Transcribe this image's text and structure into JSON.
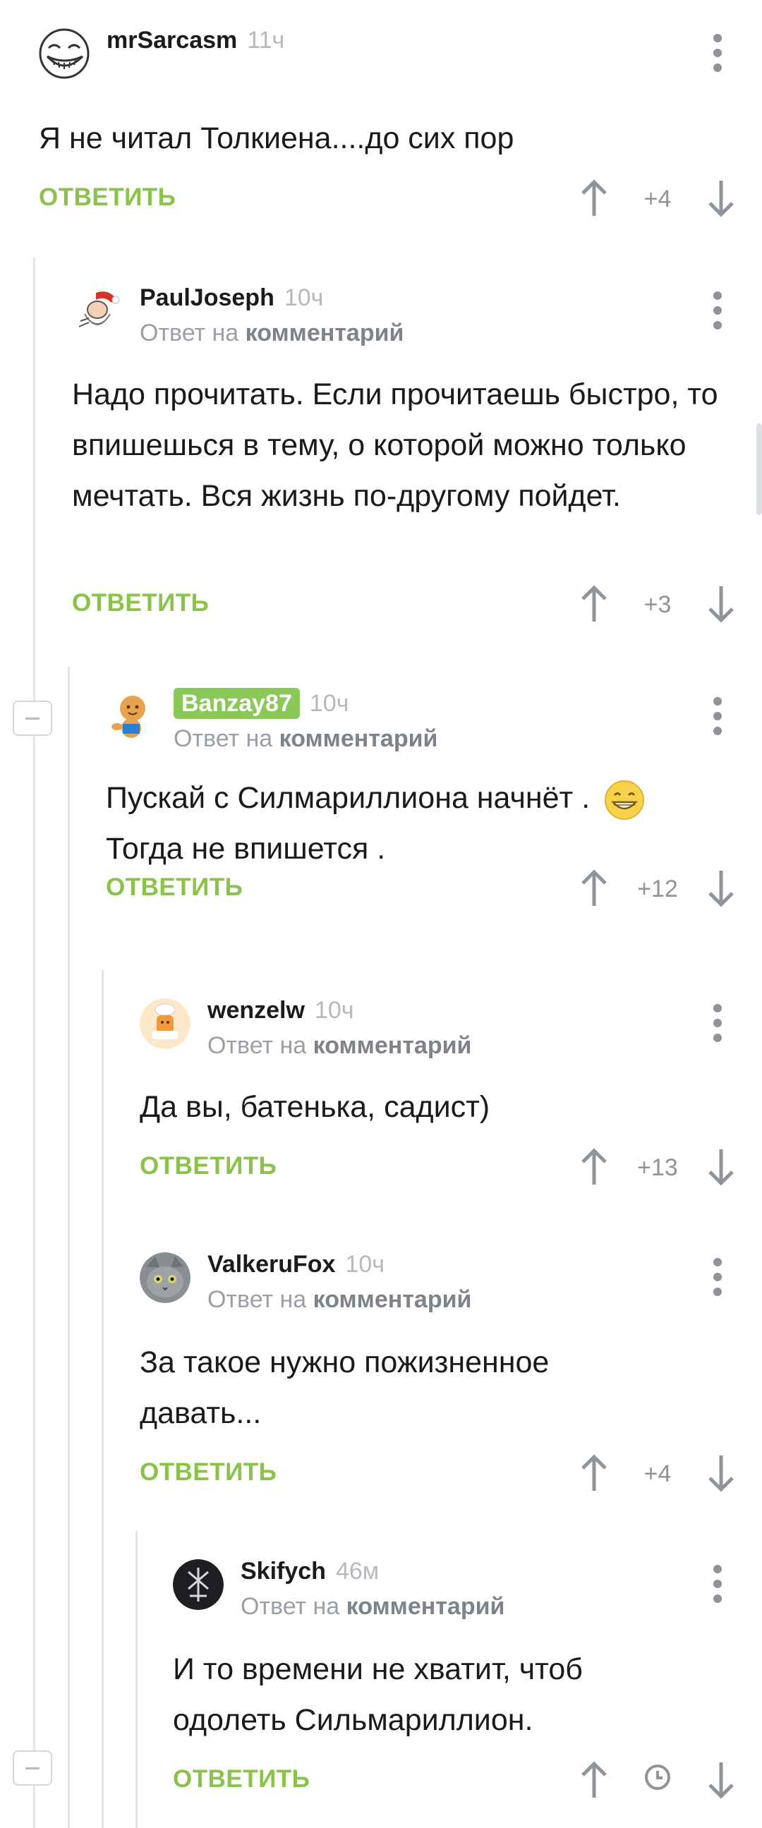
{
  "labels": {
    "reply": "ОТВЕТИТЬ",
    "reply_to": "Ответ на",
    "comment_word": "комментарий"
  },
  "colors": {
    "accent_green": "#8bc34a",
    "badge_green": "#8ac858"
  },
  "comments": [
    {
      "author": "mrSarcasm",
      "time": "11ч",
      "text": "Я не читал Толкиена....до сих пор",
      "rating": "+4",
      "avatar_icon": "trollface-icon"
    },
    {
      "author": "PaulJoseph",
      "time": "10ч",
      "text": "Надо прочитать. Если прочитаешь быстро, то впишешься в тему, о которой можно только мечтать. Вся жизнь по-другому пойдет.",
      "rating": "+3",
      "avatar_icon": "santa-avatar-icon"
    },
    {
      "author": "Banzay87",
      "time": "10ч",
      "text": "Пускай с Силмариллиона начнёт .",
      "text2": "Тогда не впишется .",
      "rating": "+12",
      "avatar_icon": "gingerbread-avatar-icon"
    },
    {
      "author": "wenzelw",
      "time": "10ч",
      "text": "Да вы, батенька, садист)",
      "rating": "+13",
      "avatar_icon": "cake-avatar-icon"
    },
    {
      "author": "ValkeruFox",
      "time": "10ч",
      "text": "За такое нужно пожизненное давать...",
      "rating": "+4",
      "avatar_icon": "cat-avatar-icon"
    },
    {
      "author": "Skifych",
      "time": "46м",
      "text": "И то времени не хватит, чтоб одолеть Сильмариллион.",
      "rating": "",
      "avatar_icon": "rune-avatar-icon"
    }
  ]
}
